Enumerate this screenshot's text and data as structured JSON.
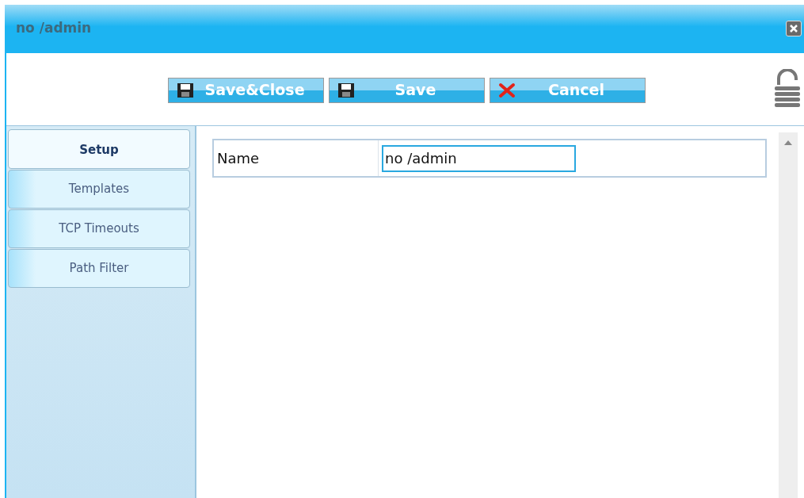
{
  "window": {
    "title": "no /admin"
  },
  "toolbar": {
    "buttons": [
      {
        "label": "Save&Close",
        "kind": "save"
      },
      {
        "label": "Save",
        "kind": "save"
      },
      {
        "label": "Cancel",
        "kind": "cancel"
      }
    ]
  },
  "tabs": [
    {
      "label": "Setup",
      "selected": true
    },
    {
      "label": "Templates",
      "selected": false
    },
    {
      "label": "TCP Timeouts",
      "selected": false
    },
    {
      "label": "Path Filter",
      "selected": false
    }
  ],
  "form": {
    "fields": [
      {
        "label": "Name",
        "value": "no /admin"
      }
    ]
  }
}
